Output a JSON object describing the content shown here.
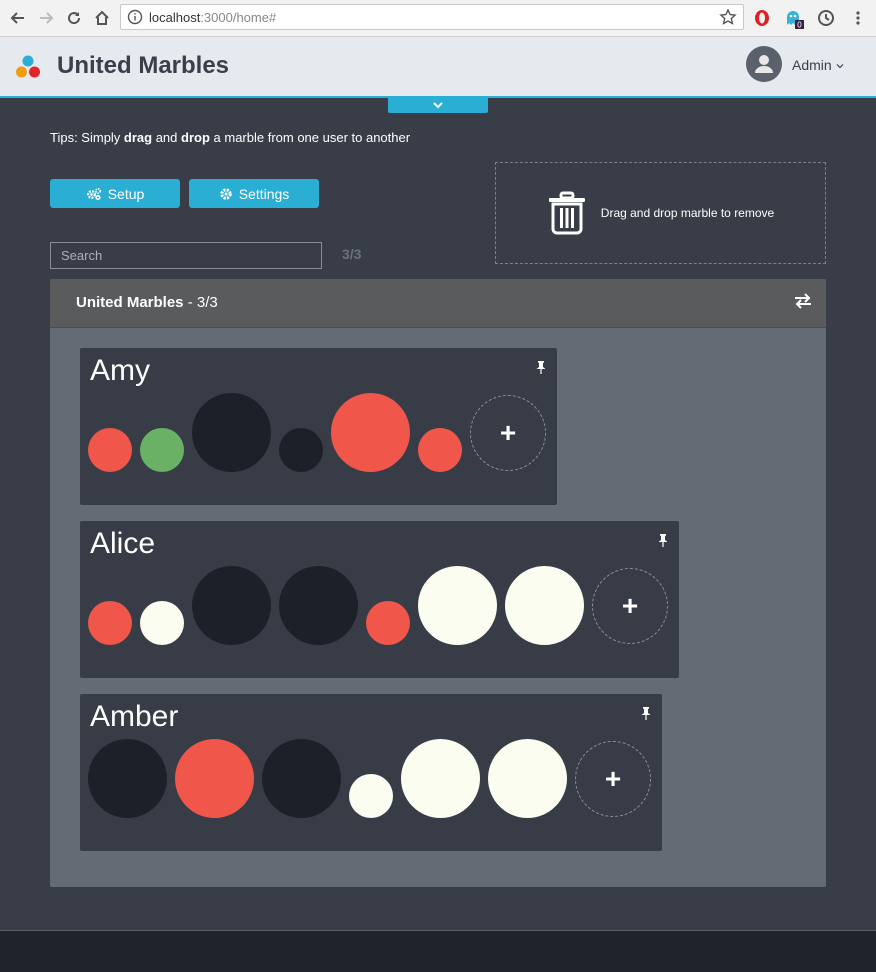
{
  "browser": {
    "url_host": "localhost",
    "url_rest": ":3000/home#",
    "extension_badge": "0"
  },
  "header": {
    "app_title": "United Marbles",
    "user_label": "Admin"
  },
  "tips": {
    "prefix": "Tips: Simply ",
    "drag": "drag",
    "and": " and ",
    "drop": "drop",
    "suffix": " a marble from one user to another"
  },
  "toolbar": {
    "setup_label": "Setup",
    "settings_label": "Settings"
  },
  "trash_zone": {
    "label": "Drag and drop marble to remove"
  },
  "search": {
    "placeholder": "Search",
    "value": "",
    "count": "3/3"
  },
  "panel": {
    "title": "United Marbles",
    "count": " - 3/3"
  },
  "colors": {
    "red": "#f0574a",
    "green": "#6ab165",
    "black": "#1d2029",
    "white": "#fcfdf1",
    "accent": "#2aaed4"
  },
  "users": [
    {
      "name": "Amy",
      "marbles": [
        {
          "color": "red",
          "size": "small"
        },
        {
          "color": "green",
          "size": "small"
        },
        {
          "color": "black",
          "size": "large"
        },
        {
          "color": "black",
          "size": "small"
        },
        {
          "color": "red",
          "size": "large"
        },
        {
          "color": "red",
          "size": "small"
        }
      ]
    },
    {
      "name": "Alice",
      "marbles": [
        {
          "color": "red",
          "size": "small"
        },
        {
          "color": "white",
          "size": "small"
        },
        {
          "color": "black",
          "size": "large"
        },
        {
          "color": "black",
          "size": "large"
        },
        {
          "color": "red",
          "size": "small"
        },
        {
          "color": "white",
          "size": "large"
        },
        {
          "color": "white",
          "size": "large"
        }
      ]
    },
    {
      "name": "Amber",
      "marbles": [
        {
          "color": "black",
          "size": "large"
        },
        {
          "color": "red",
          "size": "large"
        },
        {
          "color": "black",
          "size": "large"
        },
        {
          "color": "white",
          "size": "small"
        },
        {
          "color": "white",
          "size": "large"
        },
        {
          "color": "white",
          "size": "large"
        }
      ]
    }
  ],
  "add_marble_label": "+"
}
